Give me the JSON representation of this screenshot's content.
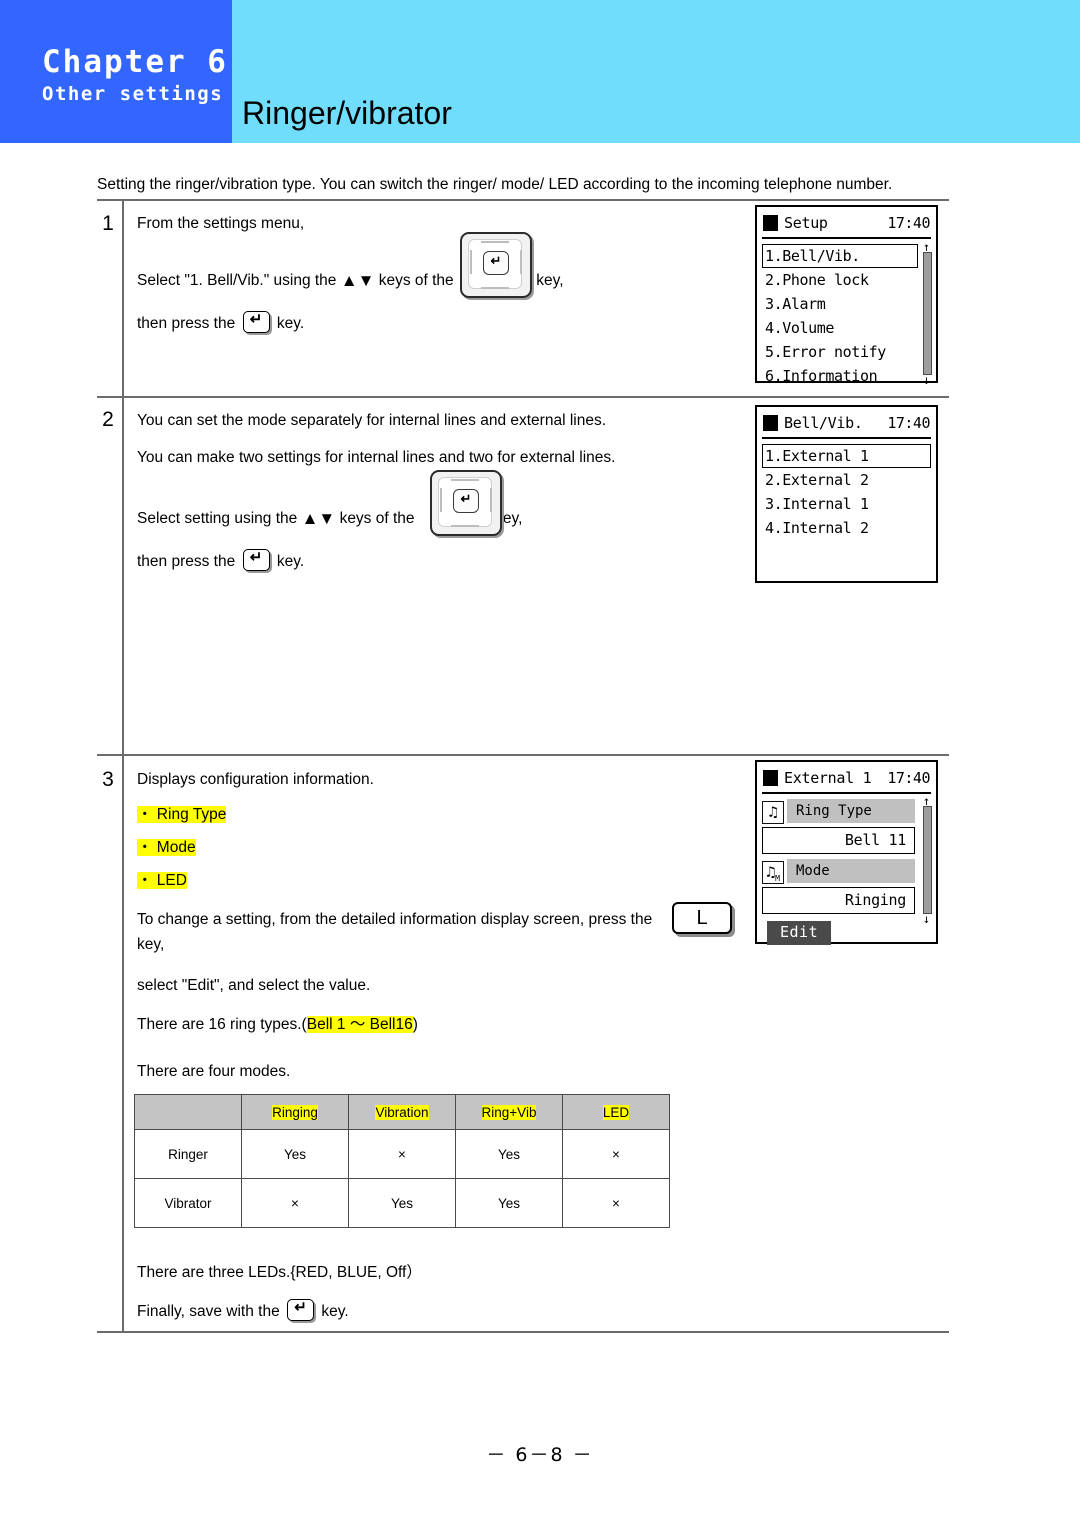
{
  "header": {
    "chapter": "Chapter 6",
    "chapter_sub": "Other settings",
    "page_title": "Ringer/vibrator",
    "block_color": "#3366FF",
    "band_color": "#6FDDFB"
  },
  "intro": "Setting the ringer/vibration type. You can switch the ringer/ mode/ LED according to the incoming telephone number.",
  "steps": [
    {
      "number": "1",
      "line1": "From the settings menu,",
      "line2_a": "Select \"1. Bell/Vib.\" using the",
      "line2_b": "keys of the",
      "line2_c": "key,",
      "line3_a": "then press the",
      "line3_b": "key."
    },
    {
      "number": "2",
      "line1": "You can set the mode separately for internal lines and external lines.",
      "line2": "You can make two settings for internal lines and two for external lines.",
      "line3_a": "Select setting using the",
      "line3_b": "keys of the",
      "line3_c": "key,",
      "line4_a": "then press the",
      "line4_b": "key."
    },
    {
      "number": "3",
      "line1": "Displays configuration information.",
      "bullet1": "・ Ring Type",
      "bullet2": "・ Mode",
      "bullet3": "・ LED",
      "line2_a": "To change a setting, from the detailed information display screen, press the",
      "line2_b": "key,",
      "line3": "select \"Edit\", and select the value.",
      "line4_a": "There are 16 ring types.(",
      "line4_hl": "Bell 1 ～ Bell16",
      "line4_b": ")",
      "modes_intro": "There are four modes.",
      "leds_line": "There are three LEDs.{RED, BLUE, Off）",
      "save_a": "Finally, save with the",
      "save_b": "key."
    }
  ],
  "lcd1": {
    "title": "Setup",
    "clock": "17:40",
    "items": [
      "1.Bell/Vib.",
      "2.Phone lock",
      "3.Alarm",
      "4.Volume",
      "5.Error notify",
      "6.Information"
    ],
    "selected_index": 0,
    "scroll_up": "↑",
    "scroll_down": "↓"
  },
  "lcd2": {
    "title": "Bell/Vib.",
    "clock": "17:40",
    "items": [
      "1.External 1",
      "2.External 2",
      "3.Internal 1",
      "4.Internal 2"
    ],
    "selected_index": 0
  },
  "lcd3": {
    "title": "External 1",
    "clock": "17:40",
    "rows": [
      {
        "icon": "music-note-icon",
        "glyph": "♫",
        "label": "Ring Type",
        "value": "Bell 11"
      },
      {
        "icon": "music-note-mode-icon",
        "glyph": "♫",
        "sub": "M",
        "label": "Mode",
        "value": "Ringing"
      }
    ],
    "edit_button": "Edit",
    "scroll_up": "↑",
    "scroll_down": "↓"
  },
  "modes_table": {
    "headers": [
      "",
      "Ringing",
      "Vibration",
      "Ring+Vib",
      "LED"
    ],
    "rows": [
      {
        "label": "Ringer",
        "cells": [
          "Yes",
          "×",
          "Yes",
          "×"
        ]
      },
      {
        "label": "Vibrator",
        "cells": [
          "×",
          "Yes",
          "Yes",
          "×"
        ]
      }
    ],
    "header_bg": "#C4C4C4",
    "highlight_color": "#FFFF00"
  },
  "footer": "－ 6－8 －"
}
